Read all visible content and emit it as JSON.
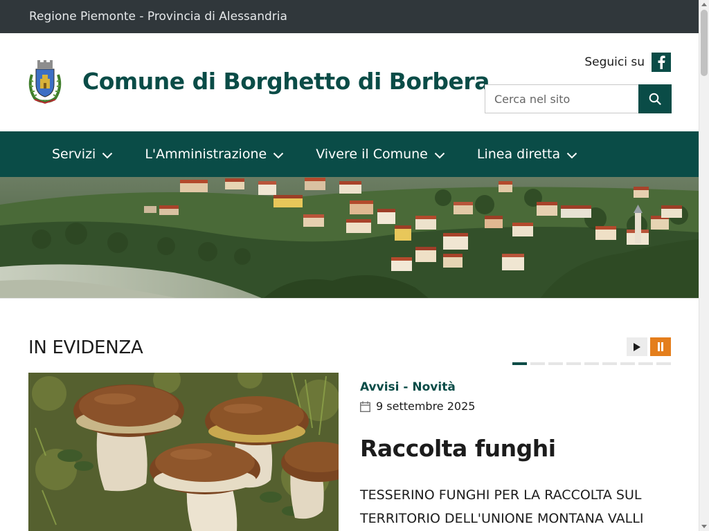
{
  "topbar": {
    "text": "Regione Piemonte - Provincia di Alessandria"
  },
  "header": {
    "title": "Comune di Borghetto di Borbera",
    "social_label": "Seguici su",
    "search_placeholder": "Cerca nel sito"
  },
  "nav": {
    "items": [
      {
        "label": "Servizi"
      },
      {
        "label": "L'Amministrazione"
      },
      {
        "label": "Vivere il Comune"
      },
      {
        "label": "Linea diretta"
      }
    ]
  },
  "highlights": {
    "title": "IN EVIDENZA",
    "slide_count": 9,
    "active_slide": 1,
    "news": {
      "category": "Avvisi - Novità",
      "date": "9 settembre 2025",
      "title": "Raccolta funghi",
      "description": "TESSERINO FUNGHI PER LA RACCOLTA SUL TERRITORIO DELL'UNIONE MONTANA VALLI"
    }
  },
  "colors": {
    "brand": "#0a4c47",
    "topbar": "#30373b",
    "accent_orange": "#e47e1c"
  },
  "icons": {
    "crest": "coat-of-arms-icon",
    "facebook": "facebook-icon",
    "search": "search-icon",
    "chevron": "chevron-down-icon",
    "play": "play-icon",
    "pause": "pause-icon",
    "calendar": "calendar-icon"
  }
}
